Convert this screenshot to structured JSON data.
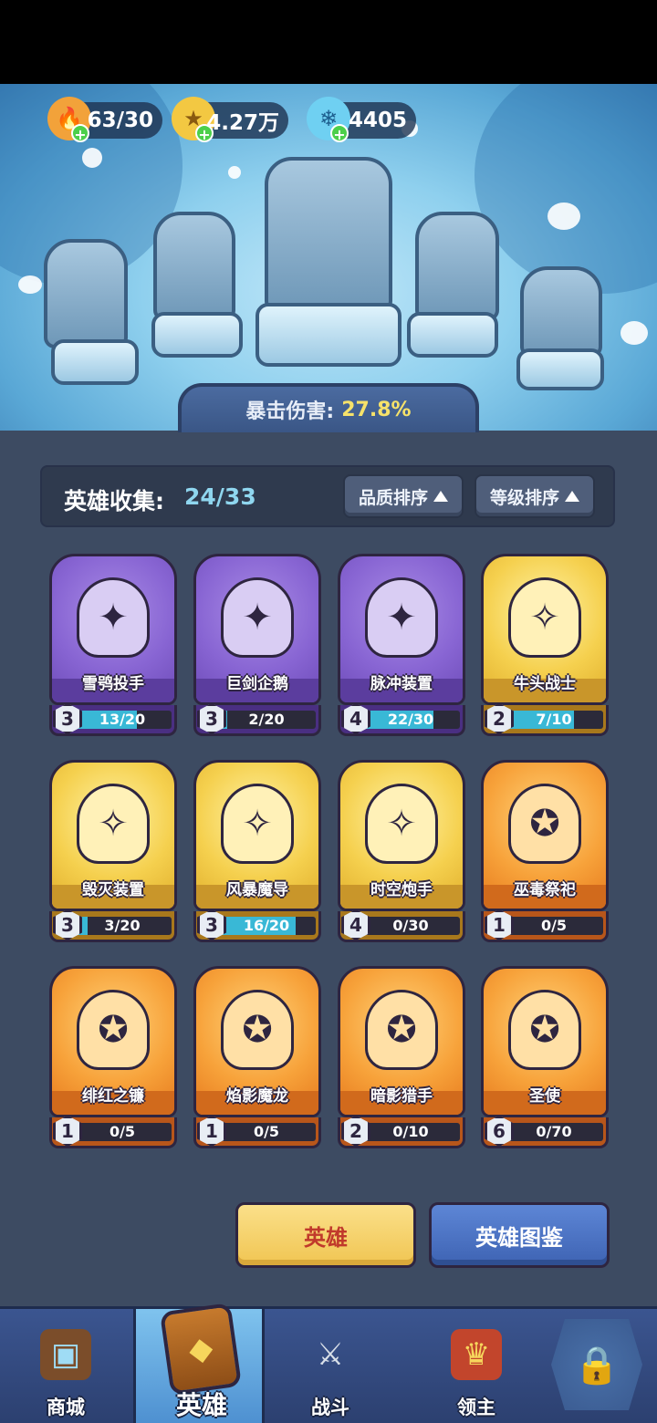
{
  "resources": [
    {
      "icon": "flame-icon",
      "value": "63/30"
    },
    {
      "icon": "gold-coin-icon",
      "value": "4.27万"
    },
    {
      "icon": "crystal-icon",
      "value": "4405"
    }
  ],
  "banner": {
    "crit_label": "暴击伤害:",
    "crit_value": "27.8%"
  },
  "collection": {
    "label": "英雄收集:",
    "count": "24/33",
    "sort_quality": "品质排序",
    "sort_level": "等级排序"
  },
  "heroes": [
    {
      "name": "雪鸮投手",
      "level": "3",
      "progress": "13/20",
      "fill": 0.65,
      "rarity": "purple"
    },
    {
      "name": "巨剑企鹅",
      "level": "3",
      "progress": "2/20",
      "fill": 0.1,
      "rarity": "purple"
    },
    {
      "name": "脉冲装置",
      "level": "4",
      "progress": "22/30",
      "fill": 0.73,
      "rarity": "purple"
    },
    {
      "name": "牛头战士",
      "level": "2",
      "progress": "7/10",
      "fill": 0.7,
      "rarity": "gold"
    },
    {
      "name": "毁灭装置",
      "level": "3",
      "progress": "3/20",
      "fill": 0.15,
      "rarity": "gold"
    },
    {
      "name": "风暴魔导",
      "level": "3",
      "progress": "16/20",
      "fill": 0.8,
      "rarity": "gold"
    },
    {
      "name": "时空炮手",
      "level": "4",
      "progress": "0/30",
      "fill": 0,
      "rarity": "gold"
    },
    {
      "name": "巫毒祭祀",
      "level": "1",
      "progress": "0/5",
      "fill": 0,
      "rarity": "orange"
    },
    {
      "name": "绯红之镰",
      "level": "1",
      "progress": "0/5",
      "fill": 0,
      "rarity": "orange"
    },
    {
      "name": "焰影魔龙",
      "level": "1",
      "progress": "0/5",
      "fill": 0,
      "rarity": "orange"
    },
    {
      "name": "暗影猎手",
      "level": "2",
      "progress": "0/10",
      "fill": 0,
      "rarity": "orange"
    },
    {
      "name": "圣使",
      "level": "6",
      "progress": "0/70",
      "fill": 0,
      "rarity": "orange"
    }
  ],
  "buttons": {
    "hero": "英雄",
    "codex": "英雄图鉴"
  },
  "nav": {
    "shop": "商城",
    "hero": "英雄",
    "battle": "战斗",
    "lord": "领主"
  }
}
